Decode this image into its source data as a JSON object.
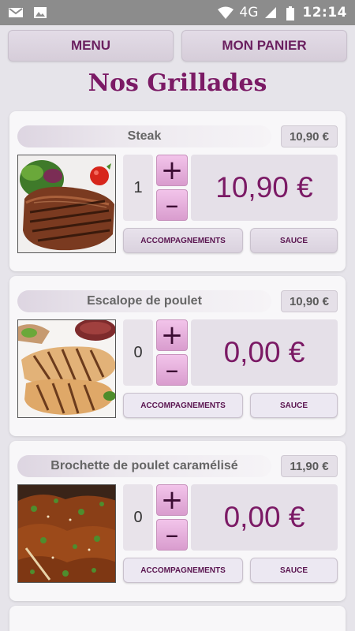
{
  "status_bar": {
    "network": "4G",
    "time": "12:14",
    "icons": [
      "gmail-icon",
      "image-icon",
      "wifi-icon",
      "signal-icon",
      "battery-icon"
    ]
  },
  "nav": {
    "menu_label": "MENU",
    "cart_label": "MON PANIER"
  },
  "page_title": "Nos Grillades",
  "products": [
    {
      "name": "Steak",
      "unit_price": "10,90 €",
      "quantity": "1",
      "total": "10,90 €",
      "sides_label": "ACCOMPAGNEMENTS",
      "sauce_label": "SAUCE",
      "photo": "steak-photo"
    },
    {
      "name": "Escalope de poulet",
      "unit_price": "10,90 €",
      "quantity": "0",
      "total": "0,00 €",
      "sides_label": "ACCOMPAGNEMENTS",
      "sauce_label": "SAUCE",
      "photo": "chicken-escalope-photo"
    },
    {
      "name": "Brochette de poulet caramélisé",
      "unit_price": "11,90 €",
      "quantity": "0",
      "total": "0,00 €",
      "sides_label": "ACCOMPAGNEMENTS",
      "sauce_label": "SAUCE",
      "photo": "chicken-skewer-photo"
    }
  ],
  "controls": {
    "plus": "+",
    "minus": "–"
  },
  "colors": {
    "accent": "#7b1a65",
    "button_pink": "#e8b4df",
    "background": "#e6e4ea"
  }
}
